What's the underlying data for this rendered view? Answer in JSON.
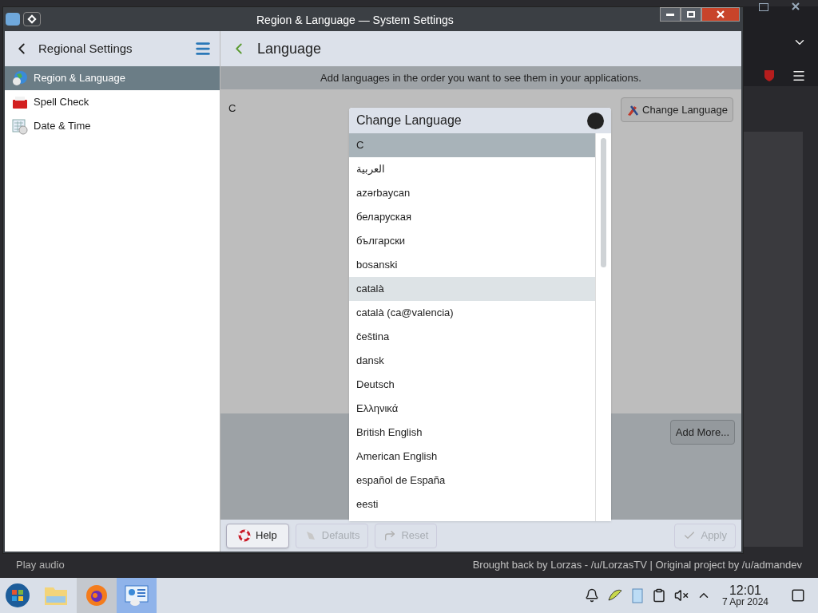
{
  "window": {
    "title": "Region & Language — System Settings"
  },
  "sidebar": {
    "title": "Regional Settings",
    "items": [
      {
        "label": "Region & Language",
        "kind": "globe",
        "selected": true
      },
      {
        "label": "Spell Check",
        "kind": "toolbox",
        "selected": false
      },
      {
        "label": "Date & Time",
        "kind": "calendar",
        "selected": false
      }
    ]
  },
  "page": {
    "title": "Language",
    "info": "Add languages in the order you want to see them in your applications.",
    "current_language": "C",
    "change_button": "Change Language",
    "add_more_button": "Add More..."
  },
  "dialog": {
    "title": "Change Language",
    "languages": [
      {
        "label": "C",
        "selected": true,
        "hovered": false
      },
      {
        "label": "العربية",
        "selected": false,
        "hovered": false
      },
      {
        "label": "azərbaycan",
        "selected": false,
        "hovered": false
      },
      {
        "label": "беларуская",
        "selected": false,
        "hovered": false
      },
      {
        "label": "български",
        "selected": false,
        "hovered": false
      },
      {
        "label": "bosanski",
        "selected": false,
        "hovered": false
      },
      {
        "label": "català",
        "selected": false,
        "hovered": true
      },
      {
        "label": "català (ca@valencia)",
        "selected": false,
        "hovered": false
      },
      {
        "label": "čeština",
        "selected": false,
        "hovered": false
      },
      {
        "label": "dansk",
        "selected": false,
        "hovered": false
      },
      {
        "label": "Deutsch",
        "selected": false,
        "hovered": false
      },
      {
        "label": "Ελληνικά",
        "selected": false,
        "hovered": false
      },
      {
        "label": "British English",
        "selected": false,
        "hovered": false
      },
      {
        "label": "American English",
        "selected": false,
        "hovered": false
      },
      {
        "label": "español de España",
        "selected": false,
        "hovered": false
      },
      {
        "label": "eesti",
        "selected": false,
        "hovered": false
      }
    ]
  },
  "buttons": [
    {
      "label": "Help",
      "kind": "help",
      "disabled": false
    },
    {
      "label": "Defaults",
      "kind": "defaults",
      "disabled": true
    },
    {
      "label": "Reset",
      "kind": "reset",
      "disabled": true
    },
    {
      "label": "Apply",
      "kind": "apply",
      "disabled": true
    }
  ],
  "background": {
    "caption_left": "Play audio",
    "caption_right": "Brought back by Lorzas - /u/LorzasTV | Original project by /u/admandev"
  },
  "taskbar": {
    "time": "12:01",
    "date": "7 Apr 2024"
  }
}
